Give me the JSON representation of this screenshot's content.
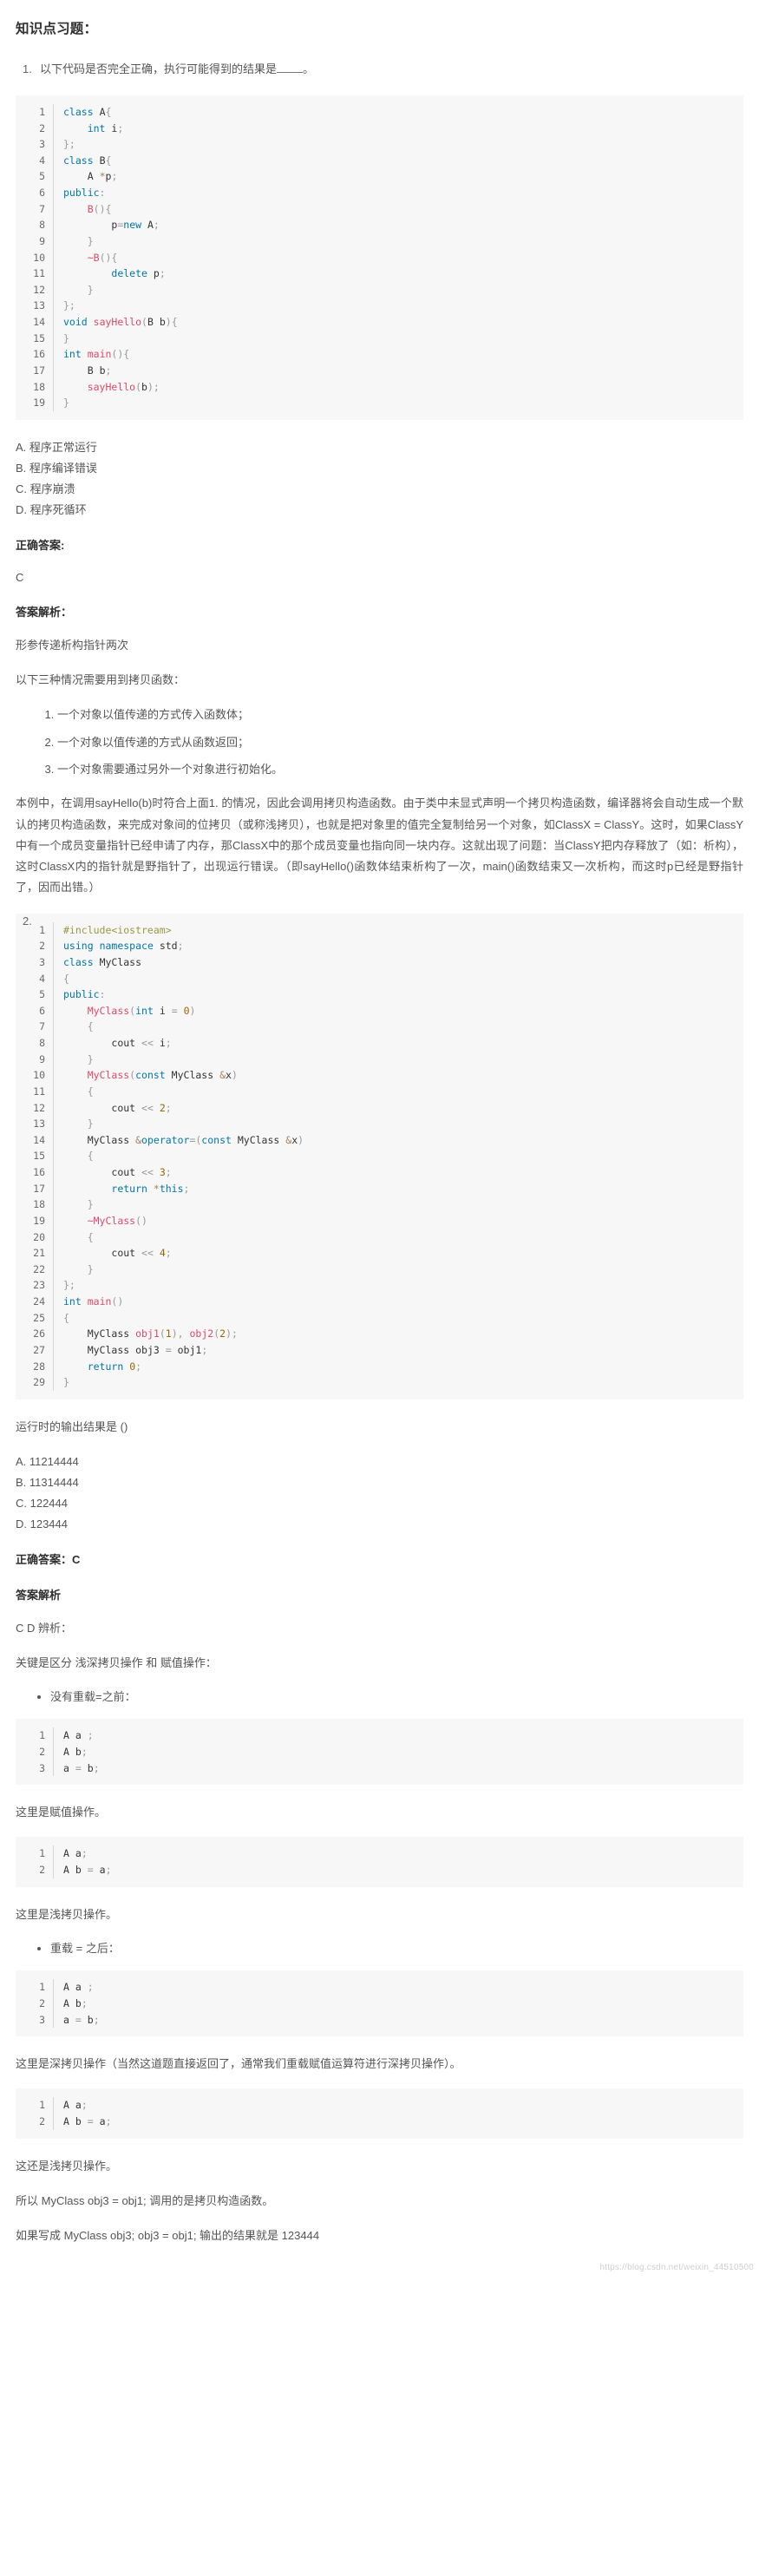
{
  "page": {
    "title": "知识点习题：",
    "watermark": "https://blog.csdn.net/weixin_44510500"
  },
  "q1": {
    "number": "1.",
    "text_before": "以下代码是否完全正确，执行可能得到的结果是",
    "blank": "",
    "text_after": "。",
    "code": [
      {
        "n": "1",
        "t": "class A{"
      },
      {
        "n": "2",
        "t": "    int i;"
      },
      {
        "n": "3",
        "t": "};"
      },
      {
        "n": "4",
        "t": "class B{"
      },
      {
        "n": "5",
        "t": "    A *p;"
      },
      {
        "n": "6",
        "t": "public:"
      },
      {
        "n": "7",
        "t": "    B(){"
      },
      {
        "n": "8",
        "t": "        p=new A;"
      },
      {
        "n": "9",
        "t": "    }"
      },
      {
        "n": "10",
        "t": "    ~B(){"
      },
      {
        "n": "11",
        "t": "        delete p;"
      },
      {
        "n": "12",
        "t": "    }"
      },
      {
        "n": "13",
        "t": "};"
      },
      {
        "n": "14",
        "t": "void sayHello(B b){"
      },
      {
        "n": "15",
        "t": "}"
      },
      {
        "n": "16",
        "t": "int main(){"
      },
      {
        "n": "17",
        "t": "    B b;"
      },
      {
        "n": "18",
        "t": "    sayHello(b);"
      },
      {
        "n": "19",
        "t": "}"
      }
    ],
    "options": [
      "A. 程序正常运行",
      "B. 程序编译错误",
      "C. 程序崩溃",
      "D. 程序死循环"
    ],
    "answer_label": "正确答案:",
    "answer_value": "C",
    "analysis_label": "答案解析：",
    "analysis_intro": "形参传递析构指针两次",
    "copy_intro": "以下三种情况需要用到拷贝函数：",
    "copy_cases": [
      "一个对象以值传递的方式传入函数体；",
      "一个对象以值传递的方式从函数返回；",
      "一个对象需要通过另外一个对象进行初始化。"
    ],
    "analysis_body": "本例中，在调用sayHello(b)时符合上面1. 的情况，因此会调用拷贝构造函数。由于类中未显式声明一个拷贝构造函数，编译器将会自动生成一个默认的拷贝构造函数，来完成对象间的位拷贝（或称浅拷贝），也就是把对象里的值完全复制给另一个对象，如ClassX = ClassY。这时，如果ClassY中有一个成员变量指针已经申请了内存，那ClassX中的那个成员变量也指向同一块内存。这就出现了问题：当ClassY把内存释放了（如：析构），这时ClassX内的指针就是野指针了，出现运行错误。（即sayHello()函数体结束析构了一次，main()函数结束又一次析构，而这时p已经是野指针了，因而出错。）"
  },
  "q2": {
    "number": "2.",
    "code": [
      {
        "n": "1",
        "t": "#include<iostream>"
      },
      {
        "n": "2",
        "t": "using namespace std;"
      },
      {
        "n": "3",
        "t": "class MyClass"
      },
      {
        "n": "4",
        "t": "{"
      },
      {
        "n": "5",
        "t": "public:"
      },
      {
        "n": "6",
        "t": "    MyClass(int i = 0)"
      },
      {
        "n": "7",
        "t": "    {"
      },
      {
        "n": "8",
        "t": "        cout << i;"
      },
      {
        "n": "9",
        "t": "    }"
      },
      {
        "n": "10",
        "t": "    MyClass(const MyClass &x)"
      },
      {
        "n": "11",
        "t": "    {"
      },
      {
        "n": "12",
        "t": "        cout << 2;"
      },
      {
        "n": "13",
        "t": "    }"
      },
      {
        "n": "14",
        "t": "    MyClass &operator=(const MyClass &x)"
      },
      {
        "n": "15",
        "t": "    {"
      },
      {
        "n": "16",
        "t": "        cout << 3;"
      },
      {
        "n": "17",
        "t": "        return *this;"
      },
      {
        "n": "18",
        "t": "    }"
      },
      {
        "n": "19",
        "t": "    ~MyClass()"
      },
      {
        "n": "20",
        "t": "    {"
      },
      {
        "n": "21",
        "t": "        cout << 4;"
      },
      {
        "n": "22",
        "t": "    }"
      },
      {
        "n": "23",
        "t": "};"
      },
      {
        "n": "24",
        "t": "int main()"
      },
      {
        "n": "25",
        "t": "{"
      },
      {
        "n": "26",
        "t": "    MyClass obj1(1), obj2(2);"
      },
      {
        "n": "27",
        "t": "    MyClass obj3 = obj1;"
      },
      {
        "n": "28",
        "t": "    return 0;"
      },
      {
        "n": "29",
        "t": "}"
      }
    ],
    "question_text": "运行时的输出结果是 ()",
    "options": [
      "A. 11214444",
      "B. 11314444",
      "C. 122444",
      "D. 123444"
    ],
    "answer_line": "正确答案：C",
    "analysis_label": "答案解析",
    "analysis_sub": "C D 辨析：",
    "key_point": "关键是区分 浅深拷贝操作 和 赋值操作：",
    "bullet1": "没有重载=之前：",
    "snippet1": [
      {
        "n": "1",
        "t": "A a ;"
      },
      {
        "n": "2",
        "t": "A b;"
      },
      {
        "n": "3",
        "t": "a = b;"
      }
    ],
    "note1": "这里是赋值操作。",
    "snippet2": [
      {
        "n": "1",
        "t": "A a;"
      },
      {
        "n": "2",
        "t": "A b = a;"
      }
    ],
    "note2": "这里是浅拷贝操作。",
    "bullet2": "重载 = 之后：",
    "snippet3": [
      {
        "n": "1",
        "t": "A a ;"
      },
      {
        "n": "2",
        "t": "A b;"
      },
      {
        "n": "3",
        "t": "a = b;"
      }
    ],
    "note3": "这里是深拷贝操作（当然这道题直接返回了，通常我们重载赋值运算符进行深拷贝操作）。",
    "snippet4": [
      {
        "n": "1",
        "t": "A a;"
      },
      {
        "n": "2",
        "t": "A b = a;"
      }
    ],
    "note4": "这还是浅拷贝操作。",
    "conclusion1": "所以 MyClass obj3 = obj1; 调用的是拷贝构造函数。",
    "conclusion2": "如果写成 MyClass obj3; obj3 = obj1; 输出的结果就是 123444"
  }
}
